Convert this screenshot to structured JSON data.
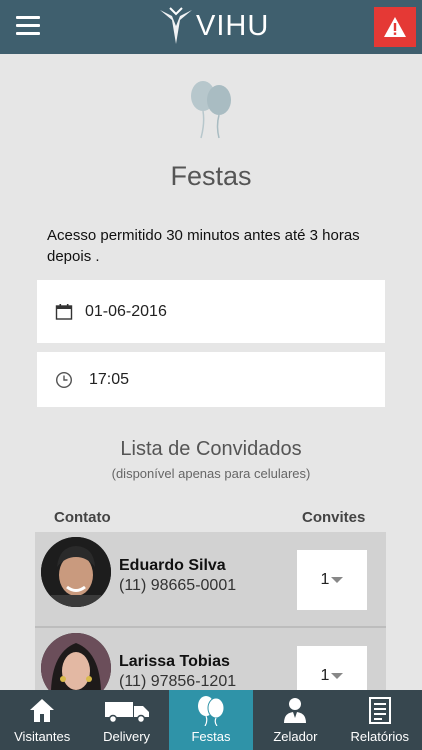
{
  "header": {
    "brand": "VIHU",
    "menu_icon": "hamburger-menu-icon",
    "alert_icon": "warning-triangle-icon"
  },
  "page": {
    "icon": "balloons-icon",
    "title": "Festas",
    "notice": "Acesso permitido 30 minutos antes até 3 horas depois ."
  },
  "form": {
    "date": {
      "icon": "calendar-icon",
      "value": "01-06-2016"
    },
    "time": {
      "icon": "clock-icon",
      "value": "17:05"
    }
  },
  "guests": {
    "title": "Lista de Convidados",
    "subtitle": "(disponível apenas para celulares)",
    "columns": {
      "contact": "Contato",
      "invites": "Convites"
    },
    "rows": [
      {
        "name": "Eduardo Silva",
        "phone": "(11) 98665-0001",
        "invites": "1"
      },
      {
        "name": "Larissa Tobias",
        "phone": "(11) 97856-1201",
        "invites": "1"
      }
    ]
  },
  "nav": {
    "items": [
      {
        "label": "Visitantes",
        "icon": "house-icon"
      },
      {
        "label": "Delivery",
        "icon": "truck-icon"
      },
      {
        "label": "Festas",
        "icon": "balloons-icon"
      },
      {
        "label": "Zelador",
        "icon": "concierge-icon"
      },
      {
        "label": "Relatórios",
        "icon": "report-icon"
      }
    ],
    "active": "Festas"
  },
  "colors": {
    "topbar": "#3f5f6e",
    "alert": "#e53935",
    "nav": "#37474f",
    "nav_active": "#2f93a8"
  }
}
